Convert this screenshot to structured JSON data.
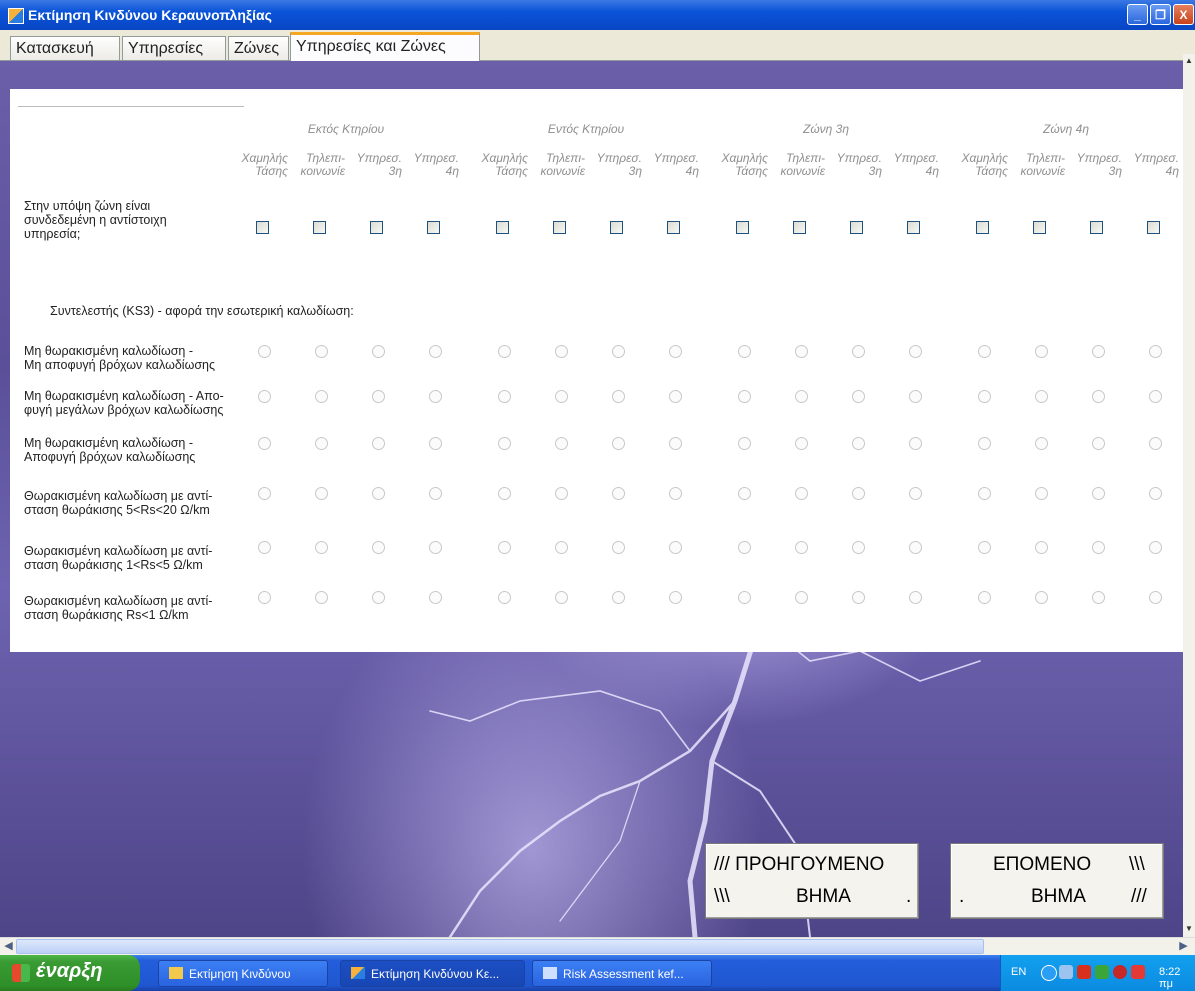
{
  "window": {
    "title": "Εκτίμηση Κινδύνου Κεραυνοπληξίας",
    "minimize": "_",
    "restore": "❐",
    "close": "X"
  },
  "tabs": [
    {
      "label": "Κατασκευή"
    },
    {
      "label": "Υπηρεσίες"
    },
    {
      "label": "Ζώνες"
    },
    {
      "label": "Υπηρεσίες και Ζώνες",
      "active": true
    }
  ],
  "groups": [
    "Εκτός Κτηρίου",
    "Εντός Κτηρίου",
    "Ζώνη 3η",
    "Ζώνη 4η"
  ],
  "columns": [
    "Χαμηλής\nΤάσης",
    "Τηλεπι-\nκοινωνίε",
    "Υπηρεσ.\n3η",
    "Υπηρεσ.\n4η"
  ],
  "connected_question": "Στην υπόψη ζώνη είναι\nσυνδεδεμένη η αντίστοιχη\nυπηρεσία;",
  "ks3_heading": "Συντελεστής (KS3) - αφορά την εσωτερική καλωδίωση:",
  "ks3_options": [
    "Μη θωρακισμένη καλωδίωση -\nΜη αποφυγή βρόχων καλωδίωσης",
    "Μη θωρακισμένη καλωδίωση - Απο-\nφυγή μεγάλων βρόχων καλωδίωσης",
    "Μη θωρακισμένη καλωδίωση -\nΑποφυγή βρόχων καλωδίωσης",
    "Θωρακισμένη καλωδίωση με αντί-\nσταση θωράκισης 5<Rs<20 Ω/km",
    "Θωρακισμένη καλωδίωση με αντί-\nσταση θωράκισης 1<Rs<5 Ω/km",
    "Θωρακισμένη καλωδίωση με αντί-\nσταση θωράκισης Rs<1 Ω/km"
  ],
  "buttons": {
    "prev": {
      "l1": "/// ΠΡΟΗΓΟΥΜΕΝΟ",
      "l2a": "\\\\\\",
      "l2b": "ΒΗΜΑ",
      "l2c": "."
    },
    "next": {
      "l1a": "ΕΠΟΜΕΝΟ",
      "l1b": "\\\\\\",
      "l2a": ".",
      "l2b": "ΒΗΜΑ",
      "l2c": "///"
    }
  },
  "taskbar": {
    "start": "έναρξη",
    "tasks": [
      "Εκτίμηση Κινδύνου",
      "Εκτίμηση Κινδύνου Κε...",
      "Risk Assessment  kef..."
    ],
    "lang": "EN",
    "time": "8:22 πμ"
  },
  "colors": {
    "accent_tab": "#f5a623",
    "titlebar": "#0a53d8",
    "taskbar": "#245edb",
    "start": "#3a9a33"
  }
}
